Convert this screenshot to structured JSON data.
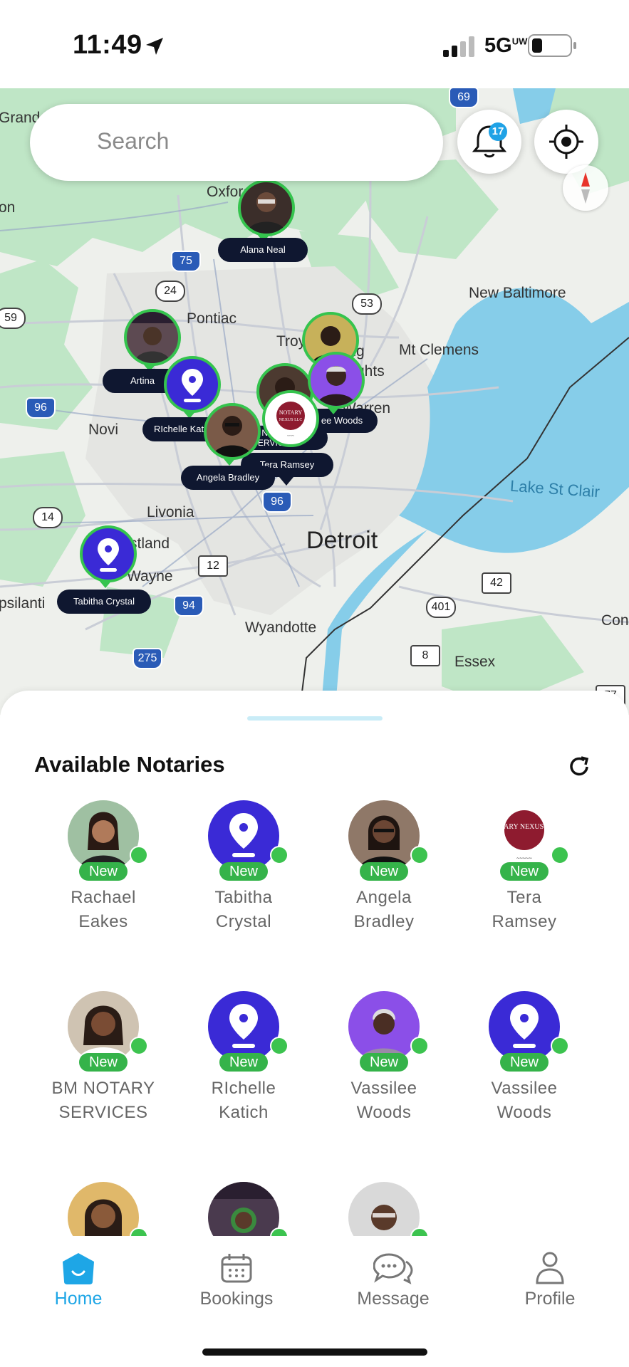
{
  "status_bar": {
    "time": "11:49",
    "network": "5G",
    "network_sup": "UW"
  },
  "search": {
    "placeholder": "Search"
  },
  "notifications": {
    "count": "17"
  },
  "map": {
    "place_labels": [
      "Grand",
      "Oxford",
      "Pontiac",
      "Troy",
      "rling",
      "ghts",
      "Mt Clemens",
      "New Baltimore",
      "Novi",
      "Warren",
      "Livonia",
      "stland",
      "Wayne",
      "Detroit",
      "psilanti",
      "Wyandotte",
      "Essex",
      "Con",
      "on",
      "Lake St Clair"
    ],
    "route_shields": [
      "69",
      "75",
      "24",
      "53",
      "59",
      "96",
      "14",
      "12",
      "96",
      "94",
      "275",
      "401",
      "42",
      "8",
      "77",
      "94"
    ],
    "pins": [
      {
        "label": "Alana Neal"
      },
      {
        "label": "Artina"
      },
      {
        "label": "RIchelle Kat"
      },
      {
        "label": "Angela Bradley"
      },
      {
        "label": "Tera Ramsey"
      },
      {
        "label": "ee Woods"
      },
      {
        "label": "M NOTARY SERVICES"
      },
      {
        "label": "Tabitha Crystal"
      }
    ]
  },
  "sheet": {
    "title": "Available Notaries",
    "new_label": "New",
    "notaries": [
      {
        "first": "Rachael",
        "last": "Eakes",
        "avatar": "photo"
      },
      {
        "first": "Tabitha",
        "last": "Crystal",
        "avatar": "location-pin"
      },
      {
        "first": "Angela",
        "last": "Bradley",
        "avatar": "photo"
      },
      {
        "first": "Tera",
        "last": "Ramsey",
        "avatar": "logo"
      },
      {
        "first": "BM NOTARY",
        "last": "SERVICES",
        "avatar": "photo"
      },
      {
        "first": "RIchelle",
        "last": "Katich",
        "avatar": "location-pin"
      },
      {
        "first": "Vassilee",
        "last": "Woods",
        "avatar": "photo"
      },
      {
        "first": "Vassilee",
        "last": "Woods",
        "avatar": "location-pin"
      }
    ],
    "logo_text": "NOTARY NEXUS LLC"
  },
  "tabs": [
    {
      "label": "Home",
      "icon": "home-icon",
      "active": true
    },
    {
      "label": "Bookings",
      "icon": "calendar-icon",
      "active": false
    },
    {
      "label": "Message",
      "icon": "chat-icon",
      "active": false
    },
    {
      "label": "Profile",
      "icon": "person-icon",
      "active": false
    }
  ],
  "colors": {
    "accent": "#1ea6e6",
    "online": "#3cc34f",
    "new_badge": "#35b34a",
    "pin_bg": "#3a2ad6",
    "tag_bg": "#0f1730",
    "water": "#86cde9",
    "park": "#bfe6c6"
  }
}
